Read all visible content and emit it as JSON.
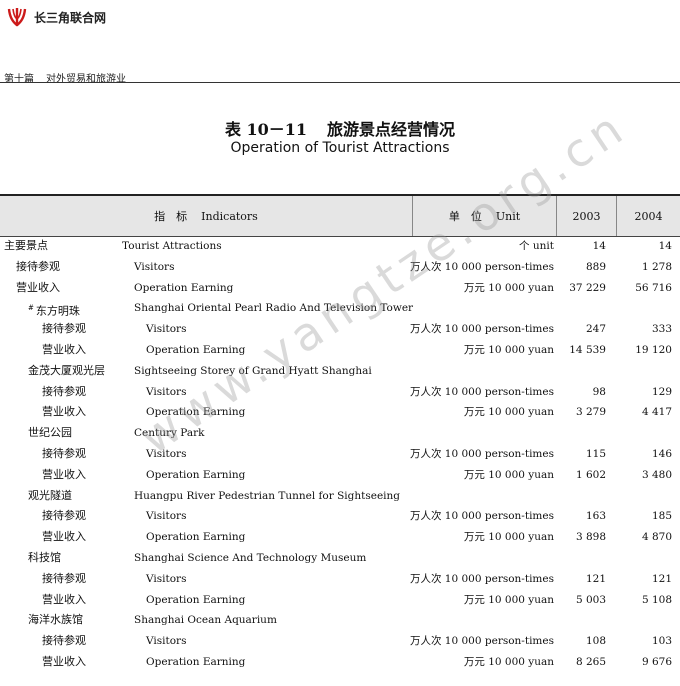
{
  "header": {
    "site_name": "长三角联合网",
    "chapter_no": "第十篇",
    "chapter_title": "对外贸易和旅游业"
  },
  "title": {
    "cn_number": "表 10－11",
    "cn": "旅游景点经营情况",
    "en": "Operation of Tourist Attractions"
  },
  "table": {
    "columns": {
      "indicator_cn": "指　标",
      "indicator_en": "Indicators",
      "unit_cn": "单　位",
      "unit_en": "Unit",
      "y2003": "2003",
      "y2004": "2004"
    },
    "rows": [
      {
        "cn": "主要景点",
        "en": "Tourist Attractions",
        "unit": "个 unit",
        "v2003": "14",
        "v2004": "14"
      },
      {
        "cn": "接待参观",
        "en": "Visitors",
        "unit": "万人次 10 000 person-times",
        "v2003": "889",
        "v2004": "1 278"
      },
      {
        "cn": "营业收入",
        "en": "Operation Earning",
        "unit": "万元 10 000 yuan",
        "v2003": "37 229",
        "v2004": "56 716"
      },
      {
        "cn": "东方明珠",
        "mark": "#",
        "en": "Shanghai Oriental Pearl Radio And Television Tower",
        "unit": "",
        "v2003": "",
        "v2004": ""
      },
      {
        "cn": "接待参观",
        "en": "Visitors",
        "unit": "万人次 10 000 person-times",
        "v2003": "247",
        "v2004": "333"
      },
      {
        "cn": "营业收入",
        "en": "Operation Earning",
        "unit": "万元 10 000 yuan",
        "v2003": "14 539",
        "v2004": "19 120"
      },
      {
        "cn": "金茂大厦观光层",
        "en": "Sightseeing Storey of Grand Hyatt Shanghai",
        "unit": "",
        "v2003": "",
        "v2004": ""
      },
      {
        "cn": "接待参观",
        "en": "Visitors",
        "unit": "万人次 10 000 person-times",
        "v2003": "98",
        "v2004": "129"
      },
      {
        "cn": "营业收入",
        "en": "Operation Earning",
        "unit": "万元 10 000 yuan",
        "v2003": "3 279",
        "v2004": "4 417"
      },
      {
        "cn": "世纪公园",
        "en": "Century Park",
        "unit": "",
        "v2003": "",
        "v2004": ""
      },
      {
        "cn": "接待参观",
        "en": "Visitors",
        "unit": "万人次 10 000 person-times",
        "v2003": "115",
        "v2004": "146"
      },
      {
        "cn": "营业收入",
        "en": "Operation Earning",
        "unit": "万元 10 000 yuan",
        "v2003": "1 602",
        "v2004": "3 480"
      },
      {
        "cn": "观光隧道",
        "en": "Huangpu River Pedestrian Tunnel for Sightseeing",
        "unit": "",
        "v2003": "",
        "v2004": ""
      },
      {
        "cn": "接待参观",
        "en": "Visitors",
        "unit": "万人次 10 000 person-times",
        "v2003": "163",
        "v2004": "185"
      },
      {
        "cn": "营业收入",
        "en": "Operation Earning",
        "unit": "万元 10 000 yuan",
        "v2003": "3 898",
        "v2004": "4 870"
      },
      {
        "cn": "科技馆",
        "en": "Shanghai Science And Technology Museum",
        "unit": "",
        "v2003": "",
        "v2004": ""
      },
      {
        "cn": "接待参观",
        "en": "Visitors",
        "unit": "万人次 10 000 person-times",
        "v2003": "121",
        "v2004": "121"
      },
      {
        "cn": "营业收入",
        "en": "Operation Earning",
        "unit": "万元 10 000 yuan",
        "v2003": "5 003",
        "v2004": "5 108"
      },
      {
        "cn": "海洋水族馆",
        "en": "Shanghai Ocean Aquarium",
        "unit": "",
        "v2003": "",
        "v2004": ""
      },
      {
        "cn": "接待参观",
        "en": "Visitors",
        "unit": "万人次 10 000 person-times",
        "v2003": "108",
        "v2004": "103"
      },
      {
        "cn": "营业收入",
        "en": "Operation Earning",
        "unit": "万元 10 000 yuan",
        "v2003": "8 265",
        "v2004": "9 676"
      }
    ]
  },
  "watermark": "www.yangtze.org.cn",
  "colors": {
    "logo_red": "#cc1a1a",
    "header_band": "#e6e6e6"
  }
}
